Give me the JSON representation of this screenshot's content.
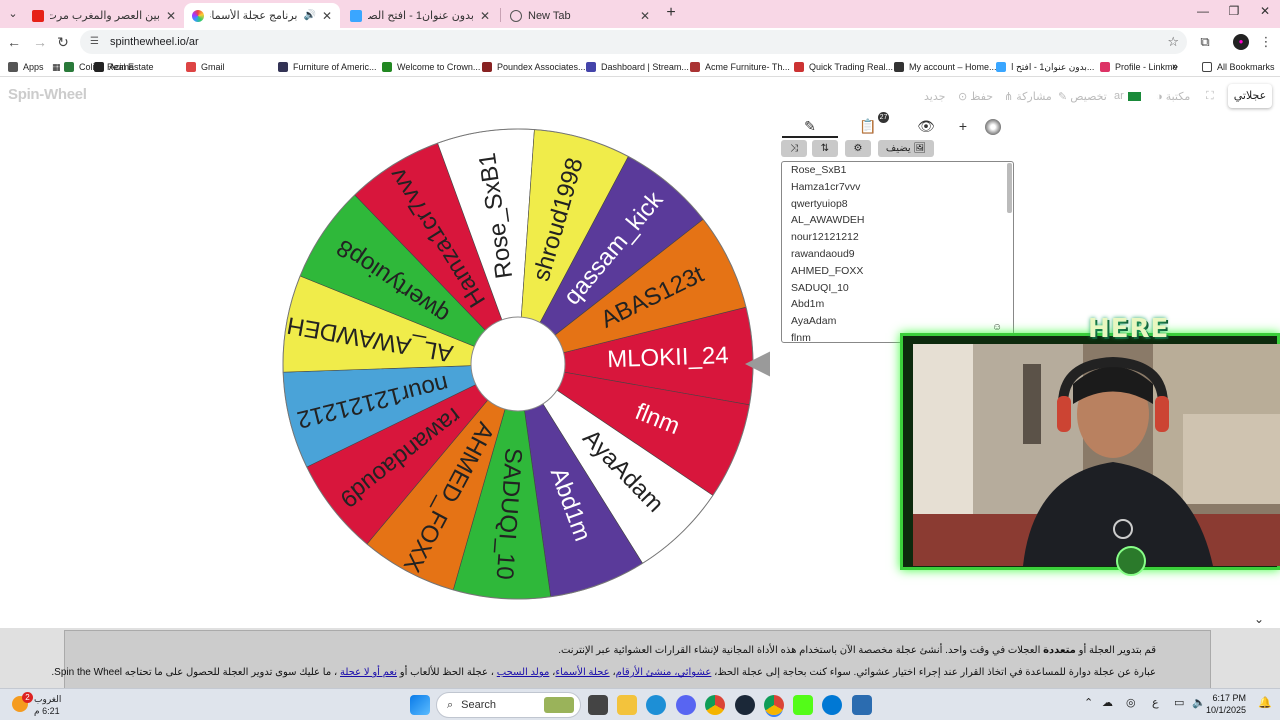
{
  "browser": {
    "tabs": [
      {
        "title": "بين العصر والمغرب مرت لمه خيال",
        "close": "✕",
        "color": "#e62117"
      },
      {
        "title": "برنامج عجلة الأسماء - أداة مد",
        "close": "✕",
        "color": "#7a5fff",
        "active": true
      },
      {
        "title": "بدون عنوان1 - افتح الصندوق",
        "close": "✕",
        "color": "#3aa6ff"
      },
      {
        "title": "New Tab",
        "close": "✕",
        "color": "#555555"
      }
    ],
    "new_tab": "+",
    "url": "spinthewheel.io/ar",
    "bookmarks": [
      {
        "label": "Apps",
        "color": "#555"
      },
      {
        "label": "Colibri Real Estate",
        "color": "#2a7a3a"
      },
      {
        "label": "Acima",
        "color": "#222"
      },
      {
        "label": "Gmail",
        "color": "#d44"
      },
      {
        "label": "Furniture of Americ...",
        "color": "#335"
      },
      {
        "label": "Welcome to Crown...",
        "color": "#282"
      },
      {
        "label": "Poundex Associates...",
        "color": "#822"
      },
      {
        "label": "Dashboard | Stream...",
        "color": "#44a"
      },
      {
        "label": "Acme Furniture- Th...",
        "color": "#a33"
      },
      {
        "label": "Quick Trading Real...",
        "color": "#c33"
      },
      {
        "label": "My account – Home...",
        "color": "#333"
      },
      {
        "label": "بدون عنوان1 - افتح ا...",
        "color": "#3aa6ff"
      },
      {
        "label": "Profile - Linkme",
        "color": "#d36"
      }
    ],
    "all_bookmarks": "All Bookmarks"
  },
  "site": {
    "logo": "Spin-Wheel",
    "nav": [
      "جديد",
      "حفظ",
      "مشاركة",
      "تخصيص",
      "مكتبة"
    ],
    "lang": "ar",
    "my_wheels": "عجلاتي"
  },
  "wheel": {
    "names": [
      "MLOKII_24",
      "flnm",
      "AyaAdam",
      "Abd1m",
      "SADUQI_10",
      "AHMED_FOXX",
      "rawandaoud9",
      "nour12121212",
      "AL_AWAWDEH",
      "qwertyuiop8",
      "Hamza1cr7vvv",
      "Rose_SxB1",
      "shroud1998",
      "qassam_kick",
      "ABAS123t"
    ],
    "colors": [
      "#d8163c",
      "#d8163c",
      "#ffffff",
      "#5a3a9a",
      "#2fb83a",
      "#e57315",
      "#d8163c",
      "#4aa3d8",
      "#f0ec4a",
      "#2fb83a",
      "#d8163c",
      "#ffffff",
      "#f0ec4a",
      "#5a3a9a",
      "#e57315"
    ],
    "text_colors": [
      "#ffffff",
      "#ffffff",
      "#222222",
      "#ffffff",
      "#222222",
      "#222222",
      "#222222",
      "#222222",
      "#222222",
      "#222222",
      "#222222",
      "#222222",
      "#222222",
      "#ffffff",
      "#222222"
    ]
  },
  "panel": {
    "tab_icons": [
      "✎",
      "📋",
      "👁",
      "+"
    ],
    "badge": "27",
    "shuffle": "⤨",
    "sort": "⇅",
    "settings": "⚙",
    "add_image": "يضيف 🖼",
    "entries": [
      "Rose_SxB1",
      "Hamza1cr7vvv",
      "qwertyuiop8",
      "AL_AWAWDEH",
      "nour12121212",
      "rawandaoud9",
      "AHMED_FOXX",
      "SADUQI_10",
      "Abd1m",
      "AyaAdam",
      "flnm"
    ]
  },
  "overlay": {
    "tag": "HERE"
  },
  "article": {
    "line1_a": "قم بتدوير العجلة أو",
    "line1_b": "متعددة",
    "line1_c": "العجلات في وقت واحد. أنشئ عجلة مخصصة الآن باستخدام هذه الأداة المجانية لإنشاء القرارات العشوائية عبر الإنترنت.",
    "line2_a": "عبارة عن عجلة دوارة للمساعدة في اتخاذ القرار عند إجراء اختيار عشوائي. سواء كنت بحاجة إلى عجلة الحظ،",
    "link1": "عشوائي، منشئ الأرقام",
    "sep": "،",
    "link2": "عجلة الأسماء",
    "link3": "مولد السحب",
    "line2_b": "، عجلة الحظ للألعاب أو",
    "link4": "نعم أو لا عجلة",
    "line2_c": "، ما عليك سوى تدوير العجلة للحصول على ما تحتاجه",
    "brand": "Spin the Wheel."
  },
  "taskbar": {
    "weather_title": "الغروب",
    "weather_time": "6:21 م",
    "weather_badge": "2",
    "search": "Search",
    "time": "6:17 PM",
    "date": "10/1/2025",
    "lang": "ع"
  }
}
